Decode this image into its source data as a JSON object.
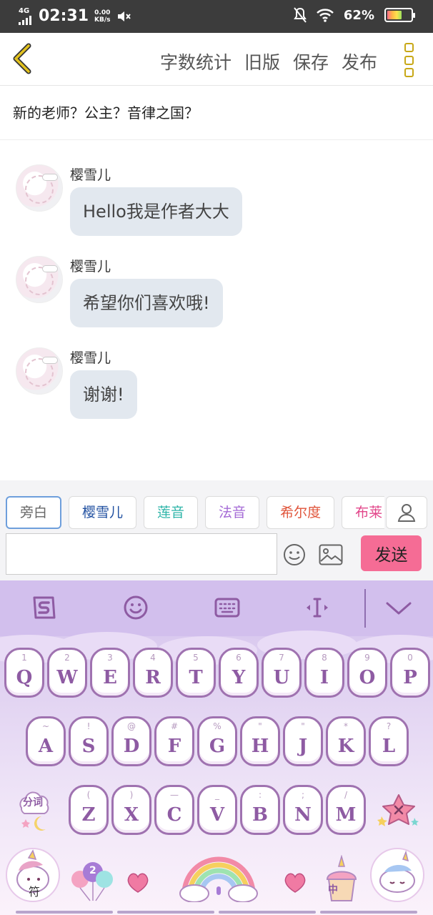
{
  "status_bar": {
    "network": "4G",
    "time": "02:31",
    "speed_value": "0.00",
    "speed_unit": "KB/s",
    "battery": "62%",
    "battery_level": 0.62
  },
  "header": {
    "actions": [
      "字数统计",
      "旧版",
      "保存",
      "发布"
    ],
    "accent_color": "#c8a817"
  },
  "chapter_title": "新的老师？公主？音律之国？",
  "messages": [
    {
      "name": "樱雪儿",
      "text": "Hello我是作者大大"
    },
    {
      "name": "樱雪儿",
      "text": "希望你们喜欢哦!"
    },
    {
      "name": "樱雪儿",
      "text": "谢谢!"
    }
  ],
  "roles": [
    {
      "label": "旁白",
      "color": "#666666"
    },
    {
      "label": "樱雪儿",
      "color": "#1f4fa0"
    },
    {
      "label": "莲音",
      "color": "#2fb5a9"
    },
    {
      "label": "法音",
      "color": "#a56bd6"
    },
    {
      "label": "希尔度",
      "color": "#e0553b"
    },
    {
      "label": "布莱",
      "color": "#e2468a"
    }
  ],
  "composer": {
    "input_value": "",
    "send_label": "发送",
    "send_color": "#f56c95"
  },
  "keyboard": {
    "row1": [
      {
        "sub": "1",
        "key": "Q"
      },
      {
        "sub": "2",
        "key": "W"
      },
      {
        "sub": "3",
        "key": "E"
      },
      {
        "sub": "4",
        "key": "R"
      },
      {
        "sub": "5",
        "key": "T"
      },
      {
        "sub": "6",
        "key": "Y"
      },
      {
        "sub": "7",
        "key": "U"
      },
      {
        "sub": "8",
        "key": "I"
      },
      {
        "sub": "9",
        "key": "O"
      },
      {
        "sub": "0",
        "key": "P"
      }
    ],
    "row2": [
      {
        "sub": "~",
        "key": "A"
      },
      {
        "sub": "!",
        "key": "S"
      },
      {
        "sub": "@",
        "key": "D"
      },
      {
        "sub": "#",
        "key": "F"
      },
      {
        "sub": "%",
        "key": "G"
      },
      {
        "sub": "\"",
        "key": "H"
      },
      {
        "sub": "\"",
        "key": "J"
      },
      {
        "sub": "*",
        "key": "K"
      },
      {
        "sub": "?",
        "key": "L"
      }
    ],
    "row3": [
      {
        "sub": "(",
        "key": "Z"
      },
      {
        "sub": ")",
        "key": "X"
      },
      {
        "sub": "—",
        "key": "C"
      },
      {
        "sub": "_",
        "key": "V"
      },
      {
        "sub": ":",
        "key": "B"
      },
      {
        "sub": ";",
        "key": "N"
      },
      {
        "sub": "/",
        "key": "M"
      }
    ],
    "split_word_label": "分词",
    "symbol_label": "符",
    "number_label": "2",
    "chinese_label": "中",
    "theme_color": "#8e5ba3"
  }
}
